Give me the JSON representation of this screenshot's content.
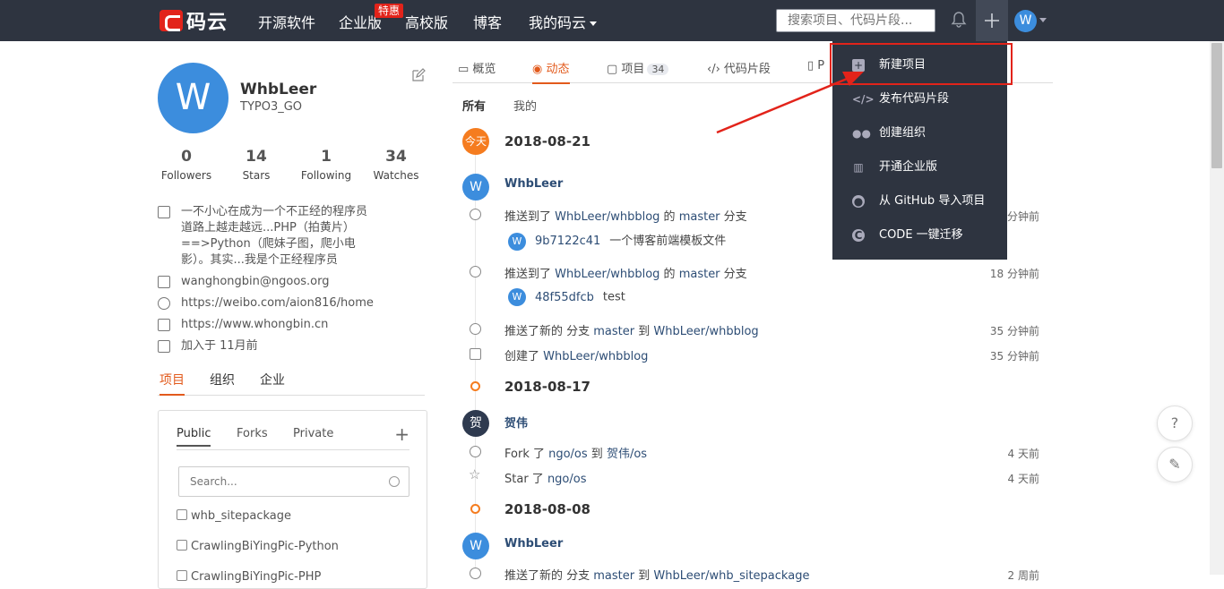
{
  "topbar": {
    "logo": "码云",
    "nav": [
      "开源软件",
      "企业版",
      "高校版",
      "博客",
      "我的码云"
    ],
    "hot_badge": "特惠",
    "search_placeholder": "搜索项目、代码片段...",
    "avatar_letter": "W"
  },
  "profile": {
    "avatar_letter": "W",
    "name": "WhbLeer",
    "username": "TYPO3_GO",
    "stats": [
      {
        "value": "0",
        "label": "Followers"
      },
      {
        "value": "14",
        "label": "Stars"
      },
      {
        "value": "1",
        "label": "Following"
      },
      {
        "value": "34",
        "label": "Watches"
      }
    ],
    "bio_lines": [
      "一不小心在成为一个不正经的程序员",
      "道路上越走越远...PHP（拍黄片）",
      "==>Python（爬妹子图，爬小电",
      "影）。其实...我是个正经程序员"
    ],
    "email": "wanghongbin@ngoos.org",
    "weibo": "https://weibo.com/aion816/home",
    "website": "https://www.whongbin.cn",
    "joined": "加入于 11月前",
    "tabs": [
      "项目",
      "组织",
      "企业"
    ],
    "sub_tabs": [
      "Public",
      "Forks",
      "Private"
    ],
    "search_placeholder": "Search...",
    "projects": [
      "whb_sitepackage",
      "CrawlingBiYingPic-Python",
      "CrawlingBiYingPic-PHP"
    ]
  },
  "main": {
    "tabs": [
      {
        "label": "概览"
      },
      {
        "label": "动态"
      },
      {
        "label": "项目",
        "count": "34"
      },
      {
        "label": "代码片段"
      },
      {
        "label": "P"
      }
    ],
    "filters": [
      "所有",
      "我的"
    ],
    "today_badge": "今天",
    "dates": [
      "2018-08-21",
      "2018-08-17",
      "2018-08-08"
    ],
    "groups": [
      {
        "user": "WhbLeer",
        "avatar": "W"
      },
      {
        "user": "贺伟",
        "avatar": "贺"
      },
      {
        "user": "WhbLeer",
        "avatar": "W"
      }
    ],
    "events": [
      {
        "pre": "推送到了 ",
        "link": "WhbLeer/whbblog",
        "mid": " 的 ",
        "link2": "master",
        "post": " 分支",
        "time": "分钟前"
      },
      {
        "pre": "推送到了 ",
        "link": "WhbLeer/whbblog",
        "mid": " 的 ",
        "link2": "master",
        "post": " 分支",
        "time": "18 分钟前"
      },
      {
        "pre": "推送了新的 分支 ",
        "link": "master",
        "mid": " 到 ",
        "link2": "WhbLeer/whbblog",
        "post": "",
        "time": "35 分钟前"
      },
      {
        "pre": "创建了 ",
        "link": "WhbLeer/whbblog",
        "mid": "",
        "link2": "",
        "post": "",
        "time": "35 分钟前"
      },
      {
        "pre": "Fork 了 ",
        "link": "ngo/os",
        "mid": " 到 ",
        "link2": "贺伟/os",
        "post": "",
        "time": "4 天前"
      },
      {
        "pre": "Star 了 ",
        "link": "ngo/os",
        "mid": "",
        "link2": "",
        "post": "",
        "time": "4 天前"
      },
      {
        "pre": "推送了新的 分支 ",
        "link": "master",
        "mid": " 到 ",
        "link2": "WhbLeer/whb_sitepackage",
        "post": "",
        "time": "2 周前"
      }
    ],
    "commits": [
      {
        "avatar": "W",
        "sha": "9b7122c41",
        "msg": "一个博客前端模板文件"
      },
      {
        "avatar": "W",
        "sha": "48f55dfcb",
        "msg": "test"
      }
    ]
  },
  "dropdown": {
    "items": [
      "新建项目",
      "发布代码片段",
      "创建组织",
      "开通企业版",
      "从 GitHub 导入项目",
      "CODE 一键迁移"
    ]
  },
  "colors": {
    "topbar": "#2e3440",
    "accent": "#e25a1c",
    "highlight": "#e2231a",
    "avatar": "#3c8ddd"
  }
}
